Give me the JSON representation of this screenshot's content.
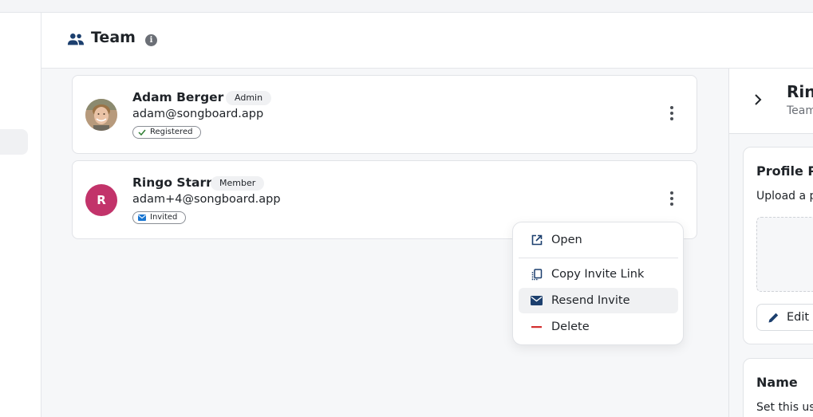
{
  "header": {
    "title": "Team",
    "info_glyph": "i",
    "team_icon": "team-icon",
    "info_icon": "info-icon"
  },
  "members": [
    {
      "name": "Adam Berger",
      "role": "Admin",
      "email": "adam@songboard.app",
      "status": "Registered",
      "status_icon": "check-icon",
      "avatar_type": "photo"
    },
    {
      "name": "Ringo Starr",
      "role": "Member",
      "email": "adam+4@songboard.app",
      "status": "Invited",
      "status_icon": "mail-icon",
      "avatar_initial": "R",
      "avatar_color": "#c2336a"
    }
  ],
  "context_menu": {
    "items": [
      {
        "label": "Open",
        "icon": "open-external-icon"
      },
      {
        "label": "Copy Invite Link",
        "icon": "copy-icon"
      },
      {
        "label": "Resend Invite",
        "icon": "mail-icon"
      },
      {
        "label": "Delete",
        "icon": "minus-icon"
      }
    ]
  },
  "detail_panel": {
    "name": "Rin",
    "subtitle": "Team",
    "profile_heading": "Profile P",
    "profile_text": "Upload a p",
    "edit_label": "Edit",
    "name_heading": "Name",
    "name_text": "Set this us"
  },
  "colors": {
    "accent": "#1c3f6e",
    "danger": "#d32f2f",
    "avatar_r": "#c2336a",
    "registered": "#2e7d32",
    "invited": "#1976d2"
  }
}
